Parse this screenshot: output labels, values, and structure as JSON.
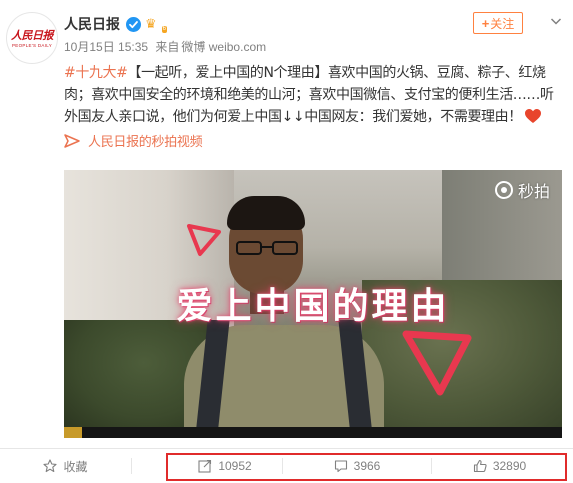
{
  "account": {
    "name": "人民日报",
    "logo_text_cn": "人民日报",
    "logo_text_en": "PEOPLE'S DAILY",
    "member_level": "6"
  },
  "meta": {
    "date": "10月15日 15:35",
    "source_prefix": "来自",
    "source": "微博 weibo.com"
  },
  "follow_label": "关注",
  "post": {
    "hashtag": "#十九大#",
    "text": "【一起听，爱上中国的N个理由】喜欢中国的火锅、豆腐、粽子、红烧肉；喜欢中国安全的环境和绝美的山河；喜欢中国微信、支付宝的便利生活……听外国友人亲口说，他们为何爱上中国↓↓中国网友：我们爱她，不需要理由！",
    "emoji": "heart"
  },
  "video": {
    "source_link": "人民日报的秒拍视频",
    "overlay_title": "爱上中国的理由",
    "watermark": "秒拍",
    "progress": 0.036
  },
  "actions": {
    "favorite": "收藏",
    "repost_count": "10952",
    "comment_count": "3966",
    "like_count": "32890"
  },
  "colors": {
    "accent": "#eb7350",
    "follow": "#ff8140",
    "verified": "#2196f3",
    "highlight": "#e02b2b",
    "heart": "#e8452c"
  },
  "icons": [
    "verified-icon",
    "crown-icon",
    "chevron-down-icon",
    "link-icon",
    "camera-icon",
    "star-icon",
    "repost-icon",
    "comment-icon",
    "like-icon",
    "heart-icon"
  ]
}
